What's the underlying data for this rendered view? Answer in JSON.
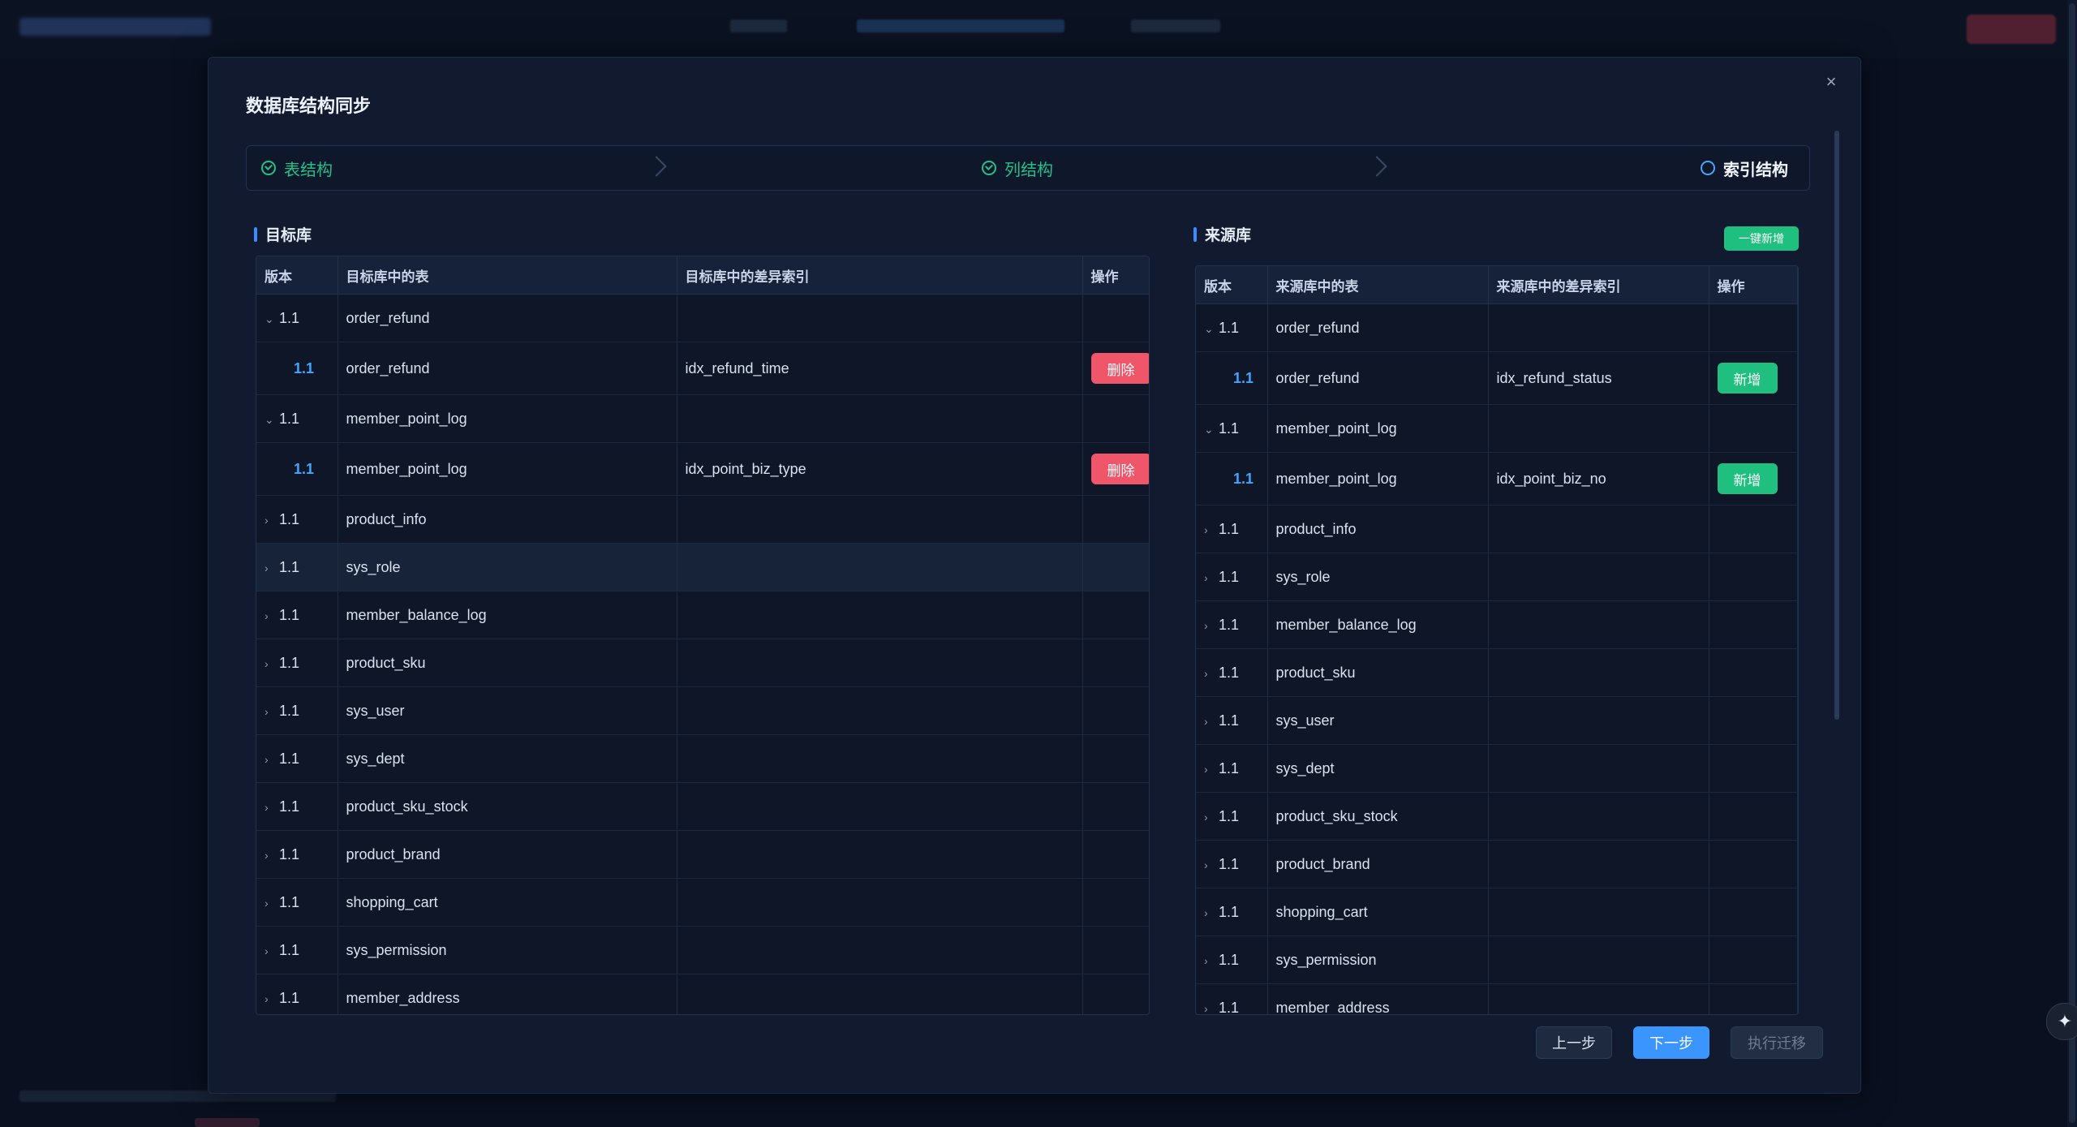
{
  "modal": {
    "title": "数据库结构同步",
    "close_glyph": "×"
  },
  "steps": [
    {
      "label": "表结构",
      "state": "done"
    },
    {
      "label": "列结构",
      "state": "done"
    },
    {
      "label": "索引结构",
      "state": "active"
    }
  ],
  "target": {
    "section_title": "目标库",
    "columns": [
      "版本",
      "目标库中的表",
      "目标库中的差异索引",
      "操作"
    ],
    "rows": [
      {
        "type": "parent",
        "expanded": true,
        "version": "1.1",
        "table": "order_refund",
        "index": "",
        "action": ""
      },
      {
        "type": "child",
        "version": "1.1",
        "table": "order_refund",
        "index": "idx_refund_time",
        "action": "删除"
      },
      {
        "type": "parent",
        "expanded": true,
        "version": "1.1",
        "table": "member_point_log",
        "index": "",
        "action": ""
      },
      {
        "type": "child",
        "version": "1.1",
        "table": "member_point_log",
        "index": "idx_point_biz_type",
        "action": "删除"
      },
      {
        "type": "parent",
        "expanded": false,
        "version": "1.1",
        "table": "product_info",
        "index": "",
        "action": ""
      },
      {
        "type": "parent",
        "expanded": false,
        "version": "1.1",
        "table": "sys_role",
        "index": "",
        "action": "",
        "highlight": true
      },
      {
        "type": "parent",
        "expanded": false,
        "version": "1.1",
        "table": "member_balance_log",
        "index": "",
        "action": ""
      },
      {
        "type": "parent",
        "expanded": false,
        "version": "1.1",
        "table": "product_sku",
        "index": "",
        "action": ""
      },
      {
        "type": "parent",
        "expanded": false,
        "version": "1.1",
        "table": "sys_user",
        "index": "",
        "action": ""
      },
      {
        "type": "parent",
        "expanded": false,
        "version": "1.1",
        "table": "sys_dept",
        "index": "",
        "action": ""
      },
      {
        "type": "parent",
        "expanded": false,
        "version": "1.1",
        "table": "product_sku_stock",
        "index": "",
        "action": ""
      },
      {
        "type": "parent",
        "expanded": false,
        "version": "1.1",
        "table": "product_brand",
        "index": "",
        "action": ""
      },
      {
        "type": "parent",
        "expanded": false,
        "version": "1.1",
        "table": "shopping_cart",
        "index": "",
        "action": ""
      },
      {
        "type": "parent",
        "expanded": false,
        "version": "1.1",
        "table": "sys_permission",
        "index": "",
        "action": ""
      },
      {
        "type": "parent",
        "expanded": false,
        "version": "1.1",
        "table": "member_address",
        "index": "",
        "action": ""
      }
    ]
  },
  "source": {
    "section_title": "来源库",
    "oneclick_label": "一键新增",
    "columns": [
      "版本",
      "来源库中的表",
      "来源库中的差异索引",
      "操作"
    ],
    "rows": [
      {
        "type": "parent",
        "expanded": true,
        "version": "1.1",
        "table": "order_refund",
        "index": "",
        "action": ""
      },
      {
        "type": "child",
        "version": "1.1",
        "table": "order_refund",
        "index": "idx_refund_status",
        "action": "新增"
      },
      {
        "type": "parent",
        "expanded": true,
        "version": "1.1",
        "table": "member_point_log",
        "index": "",
        "action": ""
      },
      {
        "type": "child",
        "version": "1.1",
        "table": "member_point_log",
        "index": "idx_point_biz_no",
        "action": "新增"
      },
      {
        "type": "parent",
        "expanded": false,
        "version": "1.1",
        "table": "product_info",
        "index": "",
        "action": ""
      },
      {
        "type": "parent",
        "expanded": false,
        "version": "1.1",
        "table": "sys_role",
        "index": "",
        "action": ""
      },
      {
        "type": "parent",
        "expanded": false,
        "version": "1.1",
        "table": "member_balance_log",
        "index": "",
        "action": ""
      },
      {
        "type": "parent",
        "expanded": false,
        "version": "1.1",
        "table": "product_sku",
        "index": "",
        "action": ""
      },
      {
        "type": "parent",
        "expanded": false,
        "version": "1.1",
        "table": "sys_user",
        "index": "",
        "action": ""
      },
      {
        "type": "parent",
        "expanded": false,
        "version": "1.1",
        "table": "sys_dept",
        "index": "",
        "action": ""
      },
      {
        "type": "parent",
        "expanded": false,
        "version": "1.1",
        "table": "product_sku_stock",
        "index": "",
        "action": ""
      },
      {
        "type": "parent",
        "expanded": false,
        "version": "1.1",
        "table": "product_brand",
        "index": "",
        "action": ""
      },
      {
        "type": "parent",
        "expanded": false,
        "version": "1.1",
        "table": "shopping_cart",
        "index": "",
        "action": ""
      },
      {
        "type": "parent",
        "expanded": false,
        "version": "1.1",
        "table": "sys_permission",
        "index": "",
        "action": ""
      },
      {
        "type": "parent",
        "expanded": false,
        "version": "1.1",
        "table": "member_address",
        "index": "",
        "action": ""
      }
    ]
  },
  "footer": {
    "prev_label": "上一步",
    "next_label": "下一步",
    "exec_label": "执行迁移"
  },
  "colors": {
    "accent": "#3a95ff",
    "success": "#1fbf7f",
    "danger": "#f0566a",
    "modal_bg": "#111a2e"
  },
  "icons": {
    "expanded": "chevron-down-icon",
    "collapsed": "chevron-right-icon",
    "close": "close-icon",
    "fab": "sparkle-icon"
  }
}
